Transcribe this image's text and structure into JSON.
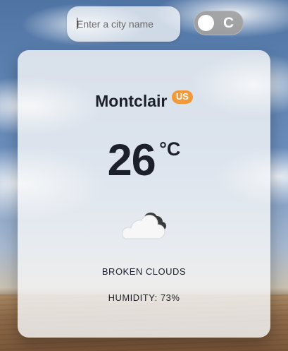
{
  "search": {
    "placeholder": "Enter a city name",
    "value": ""
  },
  "unit_toggle": {
    "label": "C"
  },
  "weather": {
    "city": "Montclair",
    "country": "US",
    "temperature": "26",
    "unit": "°C",
    "condition": "BROKEN CLOUDS",
    "humidity_label": "HUMIDITY:",
    "humidity_value": "73%",
    "humidity_text": "HUMIDITY: 73%",
    "icon": "broken-clouds-icon"
  },
  "colors": {
    "badge": "#f29a3a",
    "text": "#1d1f2a"
  }
}
